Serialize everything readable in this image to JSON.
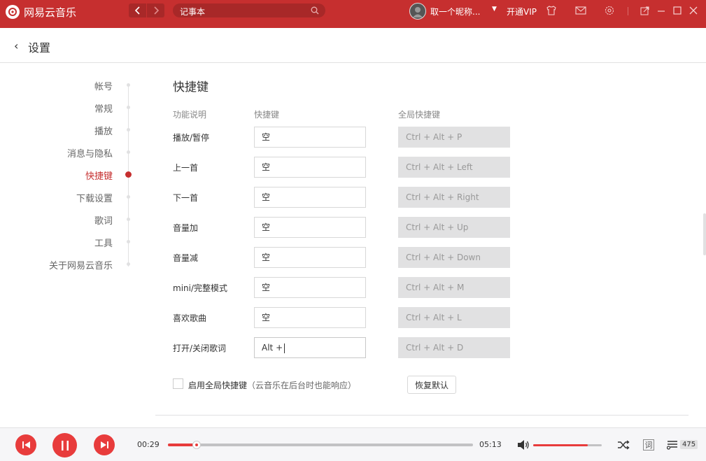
{
  "app": {
    "title": "网易云音乐",
    "logo_icon": "netease-music-logo"
  },
  "titlebar": {
    "search_value": "记事本",
    "user_name": "取一个昵称...",
    "vip_label": "开通VIP",
    "icons": [
      "back-arrow-icon",
      "forward-arrow-icon",
      "search-icon",
      "caret-down-icon",
      "tshirt-icon",
      "mail-icon",
      "gear-icon",
      "mini-mode-icon",
      "minimize-icon",
      "maximize-icon",
      "close-icon"
    ]
  },
  "header": {
    "back_glyph": "‹",
    "title": "设置"
  },
  "settings_nav": {
    "items": [
      {
        "label": "帐号",
        "active": false
      },
      {
        "label": "常规",
        "active": false
      },
      {
        "label": "播放",
        "active": false
      },
      {
        "label": "消息与隐私",
        "active": false
      },
      {
        "label": "快捷键",
        "active": true
      },
      {
        "label": "下载设置",
        "active": false
      },
      {
        "label": "歌词",
        "active": false
      },
      {
        "label": "工具",
        "active": false
      },
      {
        "label": "关于网易云音乐",
        "active": false
      }
    ]
  },
  "shortcuts": {
    "section_title": "快捷键",
    "columns": {
      "description": "功能说明",
      "shortcut": "快捷键",
      "global": "全局快捷键"
    },
    "rows": [
      {
        "label": "播放/暂停",
        "shortcut": "空",
        "global": "Ctrl + Alt + P"
      },
      {
        "label": "上一首",
        "shortcut": "空",
        "global": "Ctrl + Alt + Left"
      },
      {
        "label": "下一首",
        "shortcut": "空",
        "global": "Ctrl + Alt + Right"
      },
      {
        "label": "音量加",
        "shortcut": "空",
        "global": "Ctrl + Alt + Up"
      },
      {
        "label": "音量减",
        "shortcut": "空",
        "global": "Ctrl + Alt + Down"
      },
      {
        "label": "mini/完整模式",
        "shortcut": "空",
        "global": "Ctrl + Alt + M"
      },
      {
        "label": "喜欢歌曲",
        "shortcut": "空",
        "global": "Ctrl + Alt + L"
      },
      {
        "label": "打开/关闭歌词",
        "shortcut": "Alt +",
        "global": "Ctrl + Alt + D"
      }
    ],
    "enable_global_label": "启用全局快捷键",
    "enable_global_hint": "（云音乐在后台时也能响应）",
    "enable_global_checked": false,
    "restore_default_label": "恢复默认"
  },
  "player": {
    "current_time": "00:29",
    "total_time": "05:13",
    "progress_fraction": 0.093,
    "volume_fraction": 0.8,
    "lyric_button": "词",
    "playlist_count": "475",
    "icons": [
      "prev-track-icon",
      "pause-icon",
      "next-track-icon",
      "volume-icon",
      "shuffle-icon",
      "lyric-icon",
      "playlist-icon"
    ]
  },
  "colors": {
    "brand_red": "#c62f2f",
    "player_red": "#e83c3c"
  }
}
